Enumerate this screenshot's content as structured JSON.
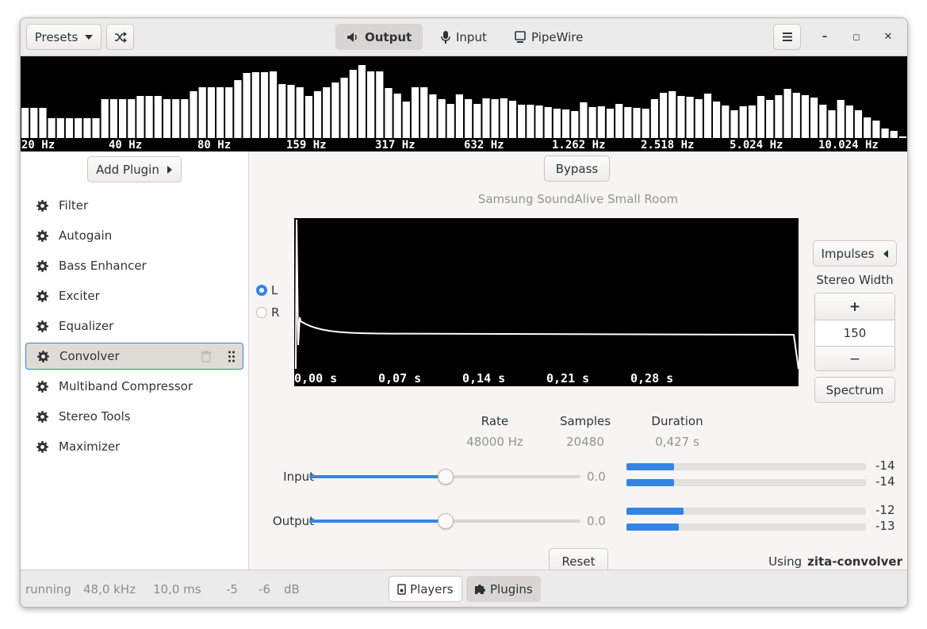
{
  "header": {
    "presets_label": "Presets",
    "shuffle_icon": "shuffle-icon",
    "tabs": [
      {
        "label": "Output",
        "icon": "speaker-icon",
        "active": true
      },
      {
        "label": "Input",
        "icon": "microphone-icon",
        "active": false
      },
      {
        "label": "PipeWire",
        "icon": "monitor-icon",
        "active": false
      }
    ],
    "menu_icon": "hamburger-menu-icon",
    "minimize_glyph": "–",
    "maximize_glyph": "◻",
    "close_glyph": "✕"
  },
  "spectrum": {
    "freq_labels": [
      "20 Hz",
      "40 Hz",
      "80 Hz",
      "159 Hz",
      "317 Hz",
      "632 Hz",
      "1.262 Hz",
      "2.518 Hz",
      "5.024 Hz",
      "10.024 Hz"
    ],
    "bar_levels": [
      0.38,
      0.38,
      0.38,
      0.25,
      0.25,
      0.25,
      0.25,
      0.25,
      0.25,
      0.49,
      0.49,
      0.49,
      0.49,
      0.53,
      0.53,
      0.53,
      0.49,
      0.49,
      0.49,
      0.59,
      0.64,
      0.64,
      0.64,
      0.64,
      0.73,
      0.82,
      0.83,
      0.83,
      0.84,
      0.68,
      0.67,
      0.64,
      0.53,
      0.59,
      0.64,
      0.7,
      0.76,
      0.86,
      0.92,
      0.84,
      0.84,
      0.63,
      0.56,
      0.46,
      0.64,
      0.64,
      0.55,
      0.49,
      0.43,
      0.55,
      0.49,
      0.43,
      0.5,
      0.49,
      0.5,
      0.47,
      0.42,
      0.42,
      0.41,
      0.39,
      0.37,
      0.36,
      0.34,
      0.45,
      0.39,
      0.4,
      0.37,
      0.43,
      0.39,
      0.38,
      0.37,
      0.49,
      0.57,
      0.59,
      0.53,
      0.52,
      0.49,
      0.56,
      0.46,
      0.41,
      0.35,
      0.4,
      0.41,
      0.53,
      0.48,
      0.54,
      0.62,
      0.57,
      0.54,
      0.51,
      0.42,
      0.35,
      0.48,
      0.41,
      0.35,
      0.26,
      0.22,
      0.12,
      0.09,
      0.02
    ]
  },
  "sidebar": {
    "add_plugin_label": "Add Plugin",
    "plugins": [
      {
        "label": "Filter"
      },
      {
        "label": "Autogain"
      },
      {
        "label": "Bass Enhancer"
      },
      {
        "label": "Exciter"
      },
      {
        "label": "Equalizer"
      },
      {
        "label": "Convolver",
        "selected": true
      },
      {
        "label": "Multiband Compressor"
      },
      {
        "label": "Stereo Tools"
      },
      {
        "label": "Maximizer"
      }
    ]
  },
  "convolver": {
    "bypass_label": "Bypass",
    "impulse_name": "Samsung SoundAlive Small Room",
    "channel_L": "L",
    "channel_R": "R",
    "selected_channel": "L",
    "time_labels": [
      "0,00 s",
      "0,07 s",
      "0,14 s",
      "0,21 s",
      "0,28 s"
    ],
    "impulses_label": "Impulses",
    "stereo_width_label": "Stereo Width",
    "stereo_width_value": "150",
    "plus_label": "+",
    "minus_label": "−",
    "spectrum_label": "Spectrum",
    "info": {
      "rate_label": "Rate",
      "rate_value": "48000 Hz",
      "samples_label": "Samples",
      "samples_value": "20480",
      "duration_label": "Duration",
      "duration_value": "0,427 s"
    },
    "input_label": "Input",
    "input_value": "0.0",
    "input_slider_fraction": 0.5,
    "output_label": "Output",
    "output_value": "0.0",
    "output_slider_fraction": 0.5,
    "input_levels": [
      {
        "text": "-14",
        "fraction": 0.2
      },
      {
        "text": "-14",
        "fraction": 0.2
      }
    ],
    "output_levels": [
      {
        "text": "-12",
        "fraction": 0.24
      },
      {
        "text": "-13",
        "fraction": 0.22
      }
    ],
    "reset_label": "Reset",
    "using_label": "Using",
    "engine_name": "zita-convolver"
  },
  "statusbar": {
    "state": "running",
    "sample_rate": "48,0 kHz",
    "latency": "10,0 ms",
    "level_left": "-5",
    "level_right": "-6",
    "level_unit": "dB",
    "tabs": [
      {
        "label": "Players",
        "icon": "player-icon",
        "active": false
      },
      {
        "label": "Plugins",
        "icon": "puzzle-icon",
        "active": true
      }
    ]
  },
  "colors": {
    "accent": "#3584e4",
    "spectrum_bg": "#000000",
    "spectrum_bar": "#ffffff"
  }
}
